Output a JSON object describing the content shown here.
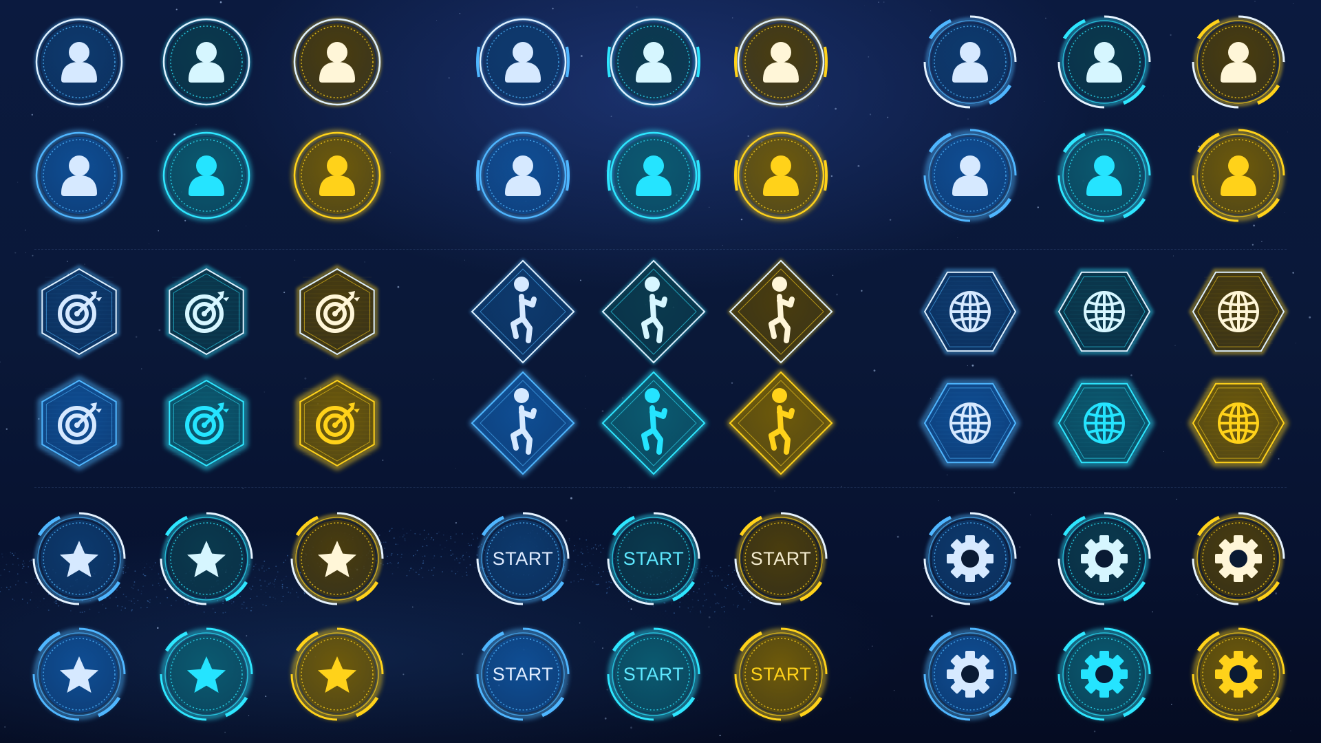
{
  "palette": {
    "blue": {
      "bright": "#4fb6ff",
      "fill": "#0d3a6e",
      "fill_active": "#0f4e94",
      "glyph": "#d6e9ff",
      "glyph_active": "#d6e9ff",
      "text": "#e0ecff",
      "text_active": "#e0ecff"
    },
    "cyan": {
      "bright": "#2ee6ff",
      "fill": "#0a3a4e",
      "fill_active": "#0b5a70",
      "glyph": "#d6f6ff",
      "glyph_active": "#25e4ff",
      "text": "#5ee8ff",
      "text_active": "#5ee8ff"
    },
    "gold": {
      "bright": "#ffd21a",
      "fill": "#4a3d0e",
      "fill_active": "#6e5a0a",
      "glyph": "#fff6d8",
      "glyph_active": "#ffd21a",
      "text": "#f4ecd0",
      "text_active": "#ffd21a"
    }
  },
  "groups": [
    {
      "id": "profile-round",
      "icon": "user-icon",
      "frame": "circle"
    },
    {
      "id": "profile-bracket",
      "icon": "user-icon",
      "frame": "circle-bracket"
    },
    {
      "id": "profile-arc",
      "icon": "user-icon",
      "frame": "circle-arc"
    },
    {
      "id": "target",
      "icon": "target-icon",
      "frame": "hexagon-pointy"
    },
    {
      "id": "climb",
      "icon": "runner-icon",
      "frame": "diamond"
    },
    {
      "id": "world",
      "icon": "globe-icon",
      "frame": "hexagon-flat"
    },
    {
      "id": "favorite",
      "icon": "star-icon",
      "frame": "circle-arc"
    },
    {
      "id": "start",
      "icon": "start-button",
      "frame": "circle-arc",
      "label": "START"
    },
    {
      "id": "settings",
      "icon": "gear-icon",
      "frame": "circle-arc"
    }
  ],
  "variant_order": [
    "blue",
    "cyan",
    "gold"
  ],
  "state_order": [
    "normal",
    "active"
  ]
}
